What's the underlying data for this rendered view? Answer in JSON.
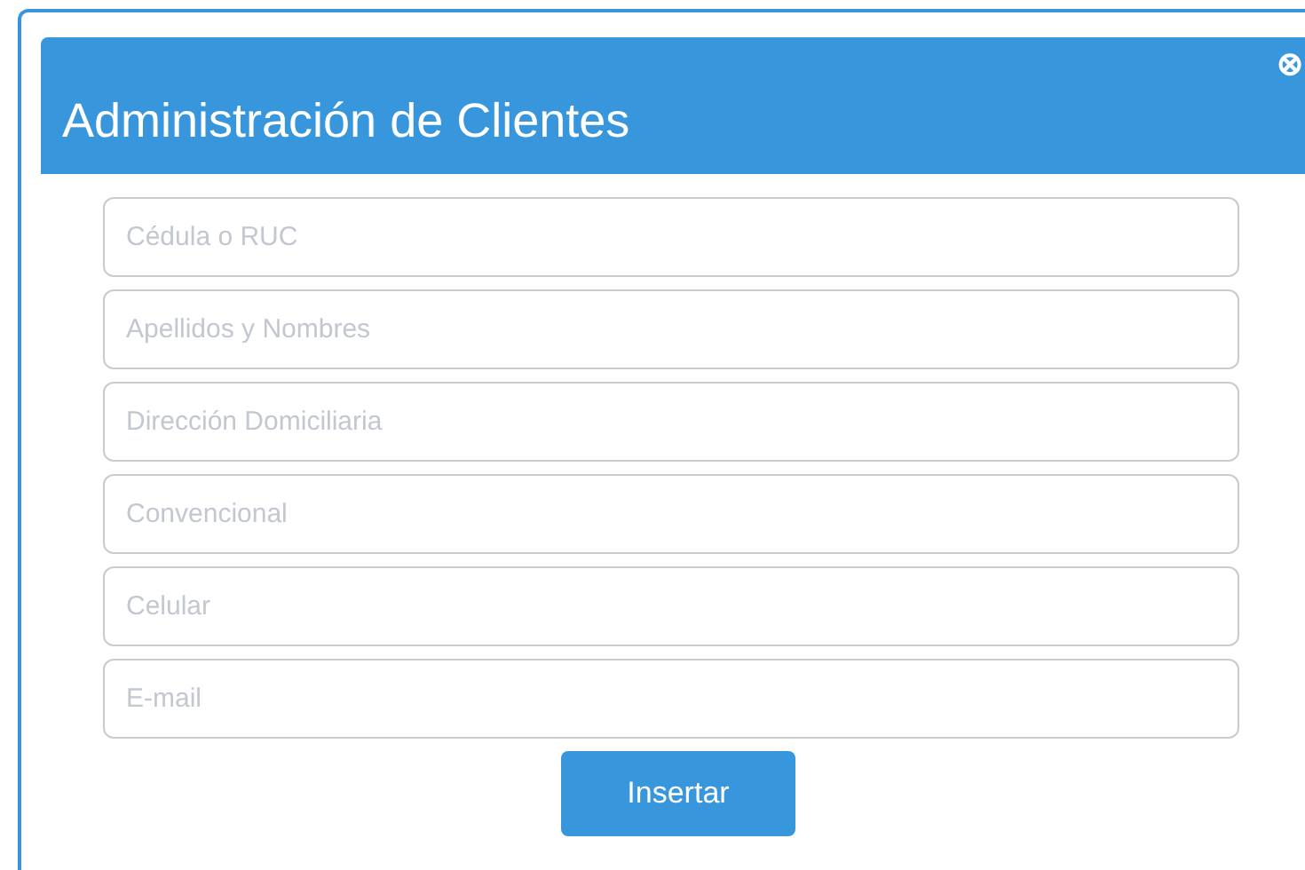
{
  "dialog": {
    "title": "Administración de Clientes",
    "close_icon": "⊗"
  },
  "fields": [
    {
      "placeholder": "Cédula o RUC"
    },
    {
      "placeholder": "Apellidos y Nombres"
    },
    {
      "placeholder": "Dirección Domiciliaria"
    },
    {
      "placeholder": "Convencional"
    },
    {
      "placeholder": "Celular"
    },
    {
      "placeholder": "E-mail"
    }
  ],
  "submit_button": "Insertar"
}
